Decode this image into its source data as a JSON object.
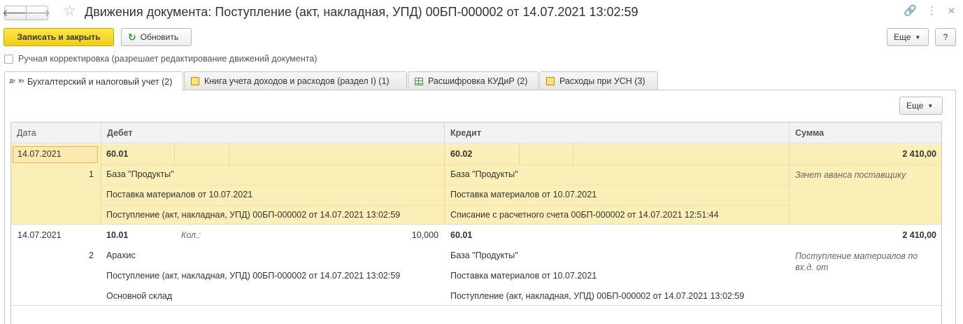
{
  "window": {
    "title": "Движения документа: Поступление (акт, накладная, УПД) 00БП-000002 от 14.07.2021 13:02:59",
    "back_glyph": "🡐",
    "forward_glyph": "🡒",
    "star_glyph": "☆",
    "link_glyph": "🔗",
    "menu_glyph": "⋮",
    "close_glyph": "✕"
  },
  "toolbar": {
    "save_close_label": "Записать и закрыть",
    "refresh_label": "Обновить",
    "refresh_glyph": "↻",
    "more_label": "Еще",
    "help_label": "?"
  },
  "manual_correction": {
    "label": "Ручная корректировка (разрешает редактирование движений документа)",
    "checked": false
  },
  "tabs": [
    {
      "label": "Бухгалтерский и налоговый учет (2)",
      "icon": "dt-kt-icon",
      "active": true
    },
    {
      "label": "Книга учета доходов и расходов (раздел I) (1)",
      "icon": "register-icon",
      "active": false
    },
    {
      "label": "Расшифровка КУДиР (2)",
      "icon": "table-icon",
      "active": false
    },
    {
      "label": "Расходы при УСН (3)",
      "icon": "register-icon",
      "active": false
    }
  ],
  "panel": {
    "more_label": "Еще"
  },
  "grid": {
    "columns": [
      "Дата",
      "Дебет",
      "Кредит",
      "Сумма"
    ],
    "records": [
      {
        "date": "14.07.2021",
        "number": "1",
        "debit_account": "60.01",
        "debit_qty_label": "",
        "debit_qty": "",
        "debit_lines": [
          "База \"Продукты\"",
          "Поставка материалов от 10.07.2021",
          "Поступление (акт, накладная, УПД) 00БП-000002 от 14.07.2021 13:02:59"
        ],
        "credit_account": "60.02",
        "credit_lines": [
          "База \"Продукты\"",
          "Поставка материалов от 10.07.2021",
          "Списание с расчетного счета 00БП-000002 от 14.07.2021 12:51:44"
        ],
        "amount": "2 410,00",
        "content": "Зачет аванса поставщику"
      },
      {
        "date": "14.07.2021",
        "number": "2",
        "debit_account": "10.01",
        "debit_qty_label": "Кол.:",
        "debit_qty": "10,000",
        "debit_lines": [
          "Арахис",
          "Поступление (акт, накладная, УПД) 00БП-000002 от 14.07.2021 13:02:59",
          "Основной склад"
        ],
        "credit_account": "60.01",
        "credit_lines": [
          "База \"Продукты\"",
          "Поставка материалов от 10.07.2021",
          "Поступление (акт, накладная, УПД) 00БП-000002 от 14.07.2021 13:02:59"
        ],
        "amount": "2 410,00",
        "content": "Поступление материалов по вх.д.  от"
      }
    ]
  }
}
